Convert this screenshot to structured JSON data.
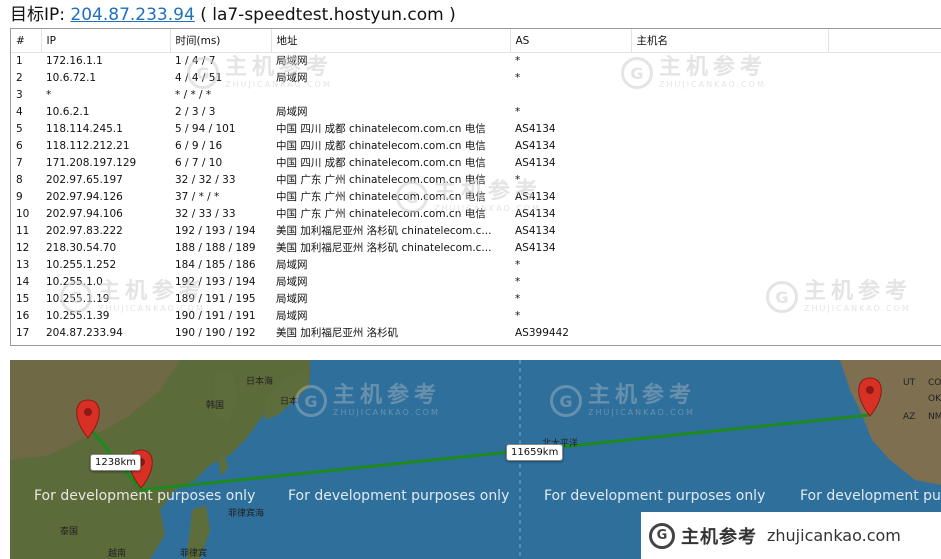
{
  "header": {
    "label": "目标IP:",
    "ip": "204.87.233.94",
    "host_text": "( la7-speedtest.hostyun.com )"
  },
  "table": {
    "columns": [
      "#",
      "IP",
      "时间(ms)",
      "地址",
      "AS",
      "主机名"
    ],
    "rows": [
      [
        "1",
        "172.16.1.1",
        "1 / 4 / 7",
        "局域网",
        "*",
        ""
      ],
      [
        "2",
        "10.6.72.1",
        "4 / 4 / 51",
        "局域网",
        "*",
        ""
      ],
      [
        "3",
        "*",
        "* / * / *",
        "",
        "",
        ""
      ],
      [
        "4",
        "10.6.2.1",
        "2 / 3 / 3",
        "局域网",
        "*",
        ""
      ],
      [
        "5",
        "118.114.245.1",
        "5 / 94 / 101",
        "中国 四川 成都 chinatelecom.com.cn 电信",
        "AS4134",
        ""
      ],
      [
        "6",
        "118.112.212.21",
        "6 / 9 / 16",
        "中国 四川 成都 chinatelecom.com.cn 电信",
        "AS4134",
        ""
      ],
      [
        "7",
        "171.208.197.129",
        "6 / 7 / 10",
        "中国 四川 成都 chinatelecom.com.cn 电信",
        "AS4134",
        ""
      ],
      [
        "8",
        "202.97.65.197",
        "32 / 32 / 33",
        "中国 广东 广州 chinatelecom.com.cn 电信",
        "*",
        ""
      ],
      [
        "9",
        "202.97.94.126",
        "37 / * / *",
        "中国 广东 广州 chinatelecom.com.cn 电信",
        "AS4134",
        ""
      ],
      [
        "10",
        "202.97.94.106",
        "32 / 33 / 33",
        "中国 广东 广州 chinatelecom.com.cn 电信",
        "AS4134",
        ""
      ],
      [
        "11",
        "202.97.83.222",
        "192 / 193 / 194",
        "美国 加利福尼亚州 洛杉矶 chinatelecom.c...",
        "AS4134",
        ""
      ],
      [
        "12",
        "218.30.54.70",
        "188 / 188 / 189",
        "美国 加利福尼亚州 洛杉矶 chinatelecom.c...",
        "AS4134",
        ""
      ],
      [
        "13",
        "10.255.1.252",
        "184 / 185 / 186",
        "局域网",
        "*",
        ""
      ],
      [
        "14",
        "10.255.1.0",
        "192 / 193 / 194",
        "局域网",
        "*",
        ""
      ],
      [
        "15",
        "10.255.1.19",
        "189 / 191 / 195",
        "局域网",
        "*",
        ""
      ],
      [
        "16",
        "10.255.1.39",
        "190 / 191 / 191",
        "局域网",
        "*",
        ""
      ],
      [
        "17",
        "204.87.233.94",
        "190 / 190 / 192",
        "美国 加利福尼亚州 洛杉矶",
        "AS399442",
        ""
      ]
    ]
  },
  "watermark": {
    "logo_char": "G",
    "cn": "主机参考",
    "en": "ZHUJICANKAO.COM"
  },
  "map": {
    "dev_text": "For development purposes only",
    "distance_1": "1238km",
    "distance_2": "11659km",
    "place_labels": [
      "日本海",
      "韩国",
      "日本",
      "泰国",
      "越南",
      "菲律宾",
      "北太平洋",
      "菲律宾海",
      "UT",
      "CO",
      "AZ",
      "NM",
      "OK"
    ],
    "route_color": "#1d8a1d",
    "pin_color": "#d93025"
  },
  "brand": {
    "logo_char": "G",
    "cn": "主机参考",
    "url": "zhujicankao.com"
  }
}
